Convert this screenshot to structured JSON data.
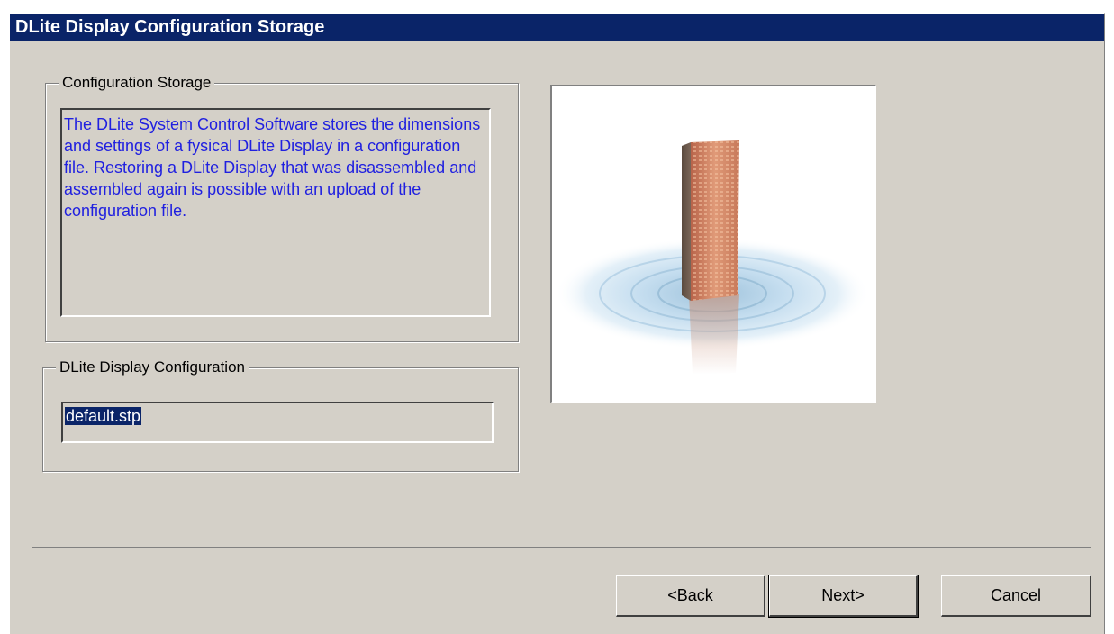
{
  "window": {
    "title": "DLite Display Configuration Storage"
  },
  "storage_group": {
    "label": "Configuration Storage",
    "description": "The DLite System Control Software stores the dimensions and settings of a fysical DLite Display in a configuration file. Restoring a DLite Display that was disassembled and assembled again is possible with an upload of the configuration file."
  },
  "config_group": {
    "label": "DLite Display Configuration",
    "filename": "default.stp"
  },
  "image": {
    "icon": "display-in-water-illustration"
  },
  "buttons": {
    "back": {
      "prefix": "< ",
      "mnemonic": "B",
      "rest": "ack"
    },
    "next": {
      "mnemonic": "N",
      "rest": "ext",
      "suffix": " >"
    },
    "cancel": "Cancel"
  },
  "colors": {
    "titlebar": "#0a2468",
    "description_text": "#2020e0",
    "dialog_face": "#d4d0c8"
  }
}
